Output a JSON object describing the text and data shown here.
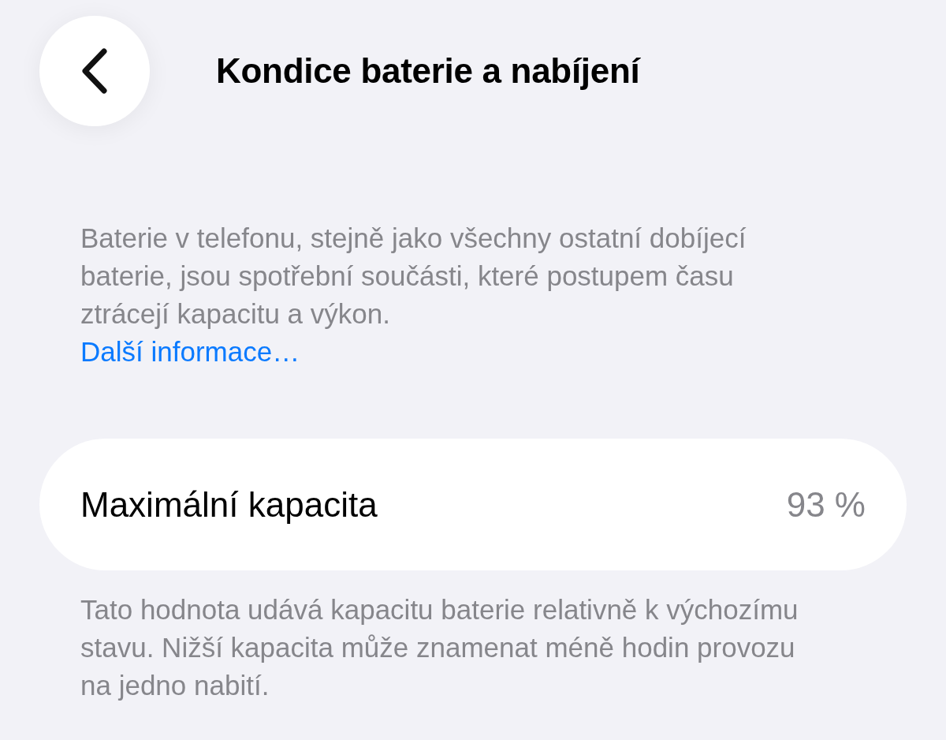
{
  "title": "Kondice baterie a nabíjení",
  "intro": {
    "text": "Baterie v telefonu, stejně jako všechny ostatní dobíjecí baterie, jsou spotřební součásti, které postupem času ztrácejí kapacitu a výkon.",
    "link": "Další informace…"
  },
  "rows": [
    {
      "label": "Maximální kapacita",
      "value": "93 %"
    }
  ],
  "footer": "Tato hodnota udává kapacitu baterie relativně k výchozímu stavu. Nižší kapacita může znamenat méně hodin provozu na jedno nabití."
}
